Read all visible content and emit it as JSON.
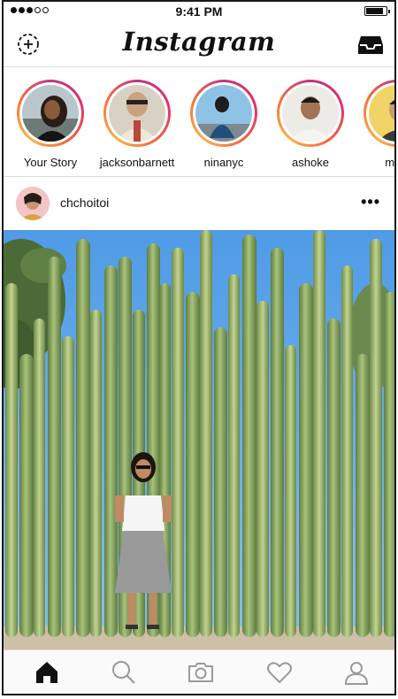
{
  "status_bar": {
    "time": "9:41 PM",
    "signal_bars_filled": 3,
    "signal_bars_total": 5,
    "battery_level": 0.8
  },
  "navbar": {
    "title": "Instagram",
    "left_icon": "add-story-icon",
    "right_icon": "inbox-icon"
  },
  "stories": [
    {
      "name": "Your Story"
    },
    {
      "name": "jacksonbarnett"
    },
    {
      "name": "ninanyc"
    },
    {
      "name": "ashoke"
    },
    {
      "name": "minz"
    }
  ],
  "post": {
    "username": "chchoitoi",
    "more_icon": "more-options-icon",
    "more_glyph": "•••"
  },
  "tabs": [
    {
      "icon": "home-icon",
      "active": true
    },
    {
      "icon": "search-icon",
      "active": false
    },
    {
      "icon": "camera-icon",
      "active": false
    },
    {
      "icon": "heart-icon",
      "active": false
    },
    {
      "icon": "profile-icon",
      "active": false
    }
  ],
  "colors": {
    "text": "#111111",
    "divider": "#dbdbdb",
    "inactive_icon": "#9a9a9a",
    "sky": "#5ea6e8",
    "cactus": "#8aa864"
  }
}
